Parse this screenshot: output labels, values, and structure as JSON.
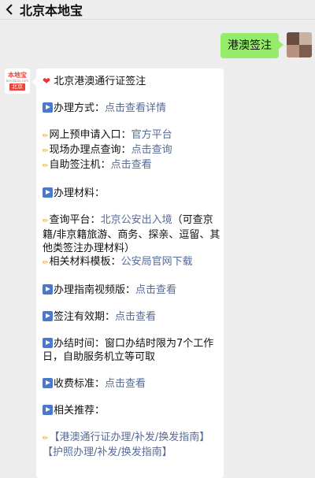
{
  "header": {
    "title": "北京本地宝"
  },
  "outgoing": {
    "text": "港澳签注"
  },
  "bot_avatar": {
    "top": "本地宝",
    "mid": "bendibao.com",
    "city": "北京"
  },
  "reply": {
    "heading": "北京港澳通行证签注",
    "handle_label": "办理方式：",
    "handle_link": "点击查看详情",
    "online_label": "网上预申请入口：",
    "online_link": "官方平台",
    "site_label": "现场办理点查询：",
    "site_link": "点击查询",
    "kiosk_label": "自助签注机：",
    "kiosk_link": "点击查看",
    "materials_label": "办理材料：",
    "query_label": "查询平台：",
    "query_link": "北京公安出入境",
    "query_note": "（可查京籍/非京籍旅游、商务、探亲、逗留、其他类签注办理材料）",
    "template_label": "相关材料模板：",
    "template_link": "公安局官网下载",
    "video_label": "办理指南视频版：",
    "video_link": "点击查看",
    "validity_label": "签注有效期：",
    "validity_link": "点击查看",
    "time_label": "办结时间：",
    "time_text": "窗口办结时限为7个工作日，自助服务机立等可取",
    "fee_label": "收费标准：",
    "fee_link": "点击查看",
    "related_label": "相关推荐：",
    "related_1": "【港澳通行证办理/补发/换发指南】",
    "related_2": "【护照办理/补发/换发指南】"
  }
}
